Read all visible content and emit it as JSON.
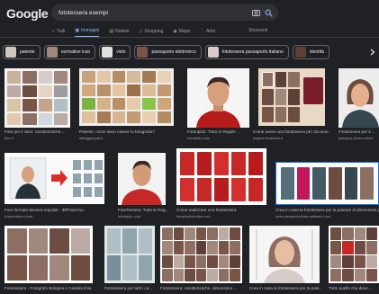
{
  "logo": "Google",
  "search": {
    "query": "fototessera esempi"
  },
  "tabs": [
    {
      "label": "Tutti",
      "active": false
    },
    {
      "label": "Immagini",
      "active": true
    },
    {
      "label": "Notizie",
      "active": false
    },
    {
      "label": "Shopping",
      "active": false
    },
    {
      "label": "Maps",
      "active": false
    },
    {
      "label": "Altro",
      "active": false
    }
  ],
  "tools_label": "Strumenti",
  "chips": [
    "patente",
    "normative icao",
    "visto",
    "passaporto elettronico",
    "fototessera passaporto italiano",
    "identità"
  ],
  "results": [
    {
      "caption": "Foto per il visto: caratteristiche,...",
      "source": "kee.fi"
    },
    {
      "caption": "Patente: come devo essere la fotografia?",
      "source": "labaggenpatt.it"
    },
    {
      "caption": "Fotoripido: Tutto in Regole ...",
      "source": "fotoripido.com"
    },
    {
      "caption": "Come avere una fototessera per docume...",
      "source": "pagina fototessera"
    },
    {
      "caption": "Fototessera per il ...",
      "source": "passport-photo.online"
    },
    {
      "caption": "Foto formato tessera requisiti - IDPhotoYou",
      "source": "it.idphotoyou.com"
    },
    {
      "caption": "FotoTessera: Tutte le Reg...",
      "source": "fotoripido.com"
    },
    {
      "caption": "Come realizzare una fototessera",
      "source": "fotostudiofenllee.com"
    },
    {
      "caption": "Crea in casa la fototessera per la patente di dimensioni perf...",
      "source": "www.passport-photo-software.com"
    },
    {
      "caption": "Fototessera - Fotografo Bologna e Casalecchio",
      "source": "fotografo.com"
    },
    {
      "caption": "Fototessera per tutti i ca...",
      "source": "fotostudio.it"
    },
    {
      "caption": "Fototessera: caratteristiche, dimensioni ...",
      "source": "fototessera.it"
    },
    {
      "caption": "Crea in casa la fototessera per la pate...",
      "source": "passport-photo-software.com"
    },
    {
      "caption": "Tutto quello che deve ...",
      "source": "fototessera.info"
    }
  ],
  "colors": {
    "accent": "#8ab4f8",
    "background": "#202124",
    "arrow": "#d93025"
  }
}
